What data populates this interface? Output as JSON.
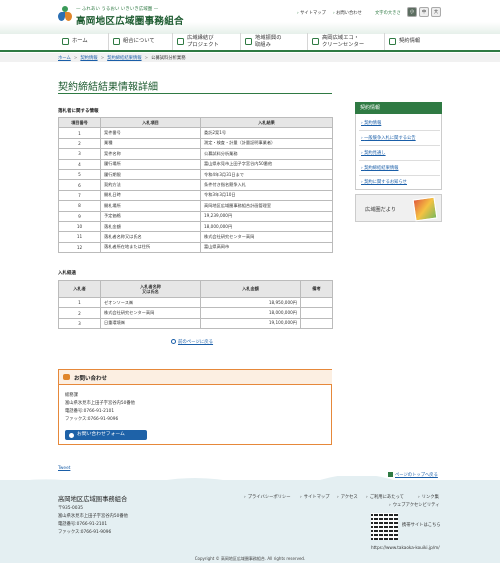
{
  "header": {
    "tagline": "— ふれあい うるおい いきいき広域圏 —",
    "title": "高岡地区広域圏事務組合",
    "sitemap": "サイトマップ",
    "contact": "お問い合わせ",
    "font_size_label": "文字の大きさ",
    "font_small": "小",
    "font_medium": "中",
    "font_large": "大"
  },
  "gnav": [
    {
      "label": "ホーム"
    },
    {
      "label": "組合について"
    },
    {
      "label": "広域縁結び\nプロジェクト"
    },
    {
      "label": "地域振興の\n取組み"
    },
    {
      "label": "高岡広域エコ・\nクリーンセンター"
    },
    {
      "label": "契約情報"
    }
  ],
  "breadcrumb": [
    "ホーム",
    "契約情報",
    "契約締結結果情報",
    "公募試料分析業務"
  ],
  "page_title": "契約締結結果情報詳細",
  "section1": {
    "heading": "落札者に関する情報",
    "headers": [
      "項目番号",
      "入札項目",
      "入札結果"
    ],
    "rows": [
      [
        "1",
        "案件番号",
        "委託2案1号"
      ],
      [
        "2",
        "業種",
        "測定・検査・計量（計量証明事業者）"
      ],
      [
        "3",
        "案件名称",
        "公募試料分析業務"
      ],
      [
        "4",
        "履行場所",
        "富山県氷見市上田子字宮谷内50番他"
      ],
      [
        "5",
        "履行期限",
        "令和4年3月31日まで"
      ],
      [
        "6",
        "契約方法",
        "条件付き指名競争入札"
      ],
      [
        "7",
        "開札日時",
        "令和3年3月10日"
      ],
      [
        "8",
        "開札場所",
        "高岡地区広域圏事務組合計画管理室"
      ],
      [
        "9",
        "予定価格",
        "19,239,000円"
      ],
      [
        "10",
        "落札金額",
        "18,000,000円"
      ],
      [
        "11",
        "落札者名称又は氏名",
        "株式会社研究センター高岡"
      ],
      [
        "12",
        "落札者所在地または住所",
        "富山県高岡市"
      ]
    ]
  },
  "section2": {
    "heading": "入札経過",
    "headers": [
      "入札者",
      "入札者名称\n又は氏名",
      "入札金額",
      "備考"
    ],
    "rows": [
      [
        "1",
        "ゼオンソース㈱",
        "18,950,000円",
        ""
      ],
      [
        "2",
        "株式会社研究センター高岡",
        "18,000,000円",
        ""
      ],
      [
        "3",
        "日重環境㈱",
        "19,100,000円",
        ""
      ]
    ]
  },
  "back_link": "前のページに戻る",
  "contact": {
    "title": "お問い合わせ",
    "dept": "総務課",
    "address": "富山県氷見市上田子字宮谷内50番他",
    "tel": "電話番号:0766-91-2101",
    "fax": "ファックス:0766-91-9096",
    "button": "お問い合わせフォーム"
  },
  "sidebar": {
    "heading": "契約情報",
    "items": [
      "契約情報",
      "一般競争入札に関する公告",
      "契約見通し",
      "契約締結結果情報",
      "契約に関するお知らせ"
    ],
    "banner": "広域圏だより"
  },
  "tweet": "Tweet",
  "pagetop": "ページのトップへ戻る",
  "footer": {
    "name": "高岡地区広域圏事務組合",
    "postal": "〒935-0035",
    "address": "富山県氷見市上田子字宮谷内50番他",
    "tel": "電話番号:0766-91-2101",
    "fax": "ファックス:0766-91-9096",
    "nav": [
      "プライバシーポリシー",
      "サイトマップ",
      "アクセス",
      "ご利用にあたって",
      "リンク集",
      "ウェブアクセシビリティ"
    ],
    "mobile": "携帯サイトはこちら",
    "url": "https://www.takaoka-kouiki.jp/m/",
    "copyright": "Copyright © 高岡地区広域圏事務組合. All rights reserved."
  }
}
